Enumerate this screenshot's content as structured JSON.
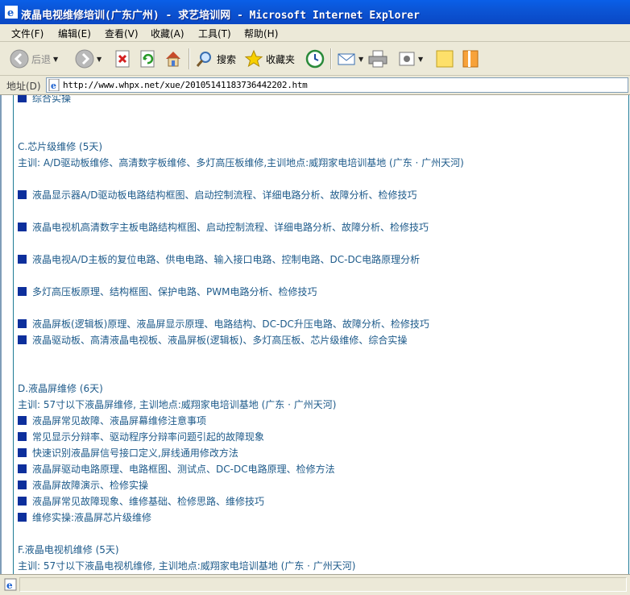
{
  "window": {
    "title": "液晶电视维修培训(广东广州) - 求艺培训网 - Microsoft Internet Explorer"
  },
  "menu": {
    "items": [
      {
        "label": "文件(F)"
      },
      {
        "label": "编辑(E)"
      },
      {
        "label": "查看(V)"
      },
      {
        "label": "收藏(A)"
      },
      {
        "label": "工具(T)"
      },
      {
        "label": "帮助(H)"
      }
    ]
  },
  "toolbar": {
    "back_label": "后退",
    "search_label": "搜索",
    "favorites_label": "收藏夹"
  },
  "address": {
    "label": "地址(D)",
    "url": "http://www.whpx.net/xue/20105141183736442202.htm"
  },
  "content": {
    "lines": [
      {
        "bullet": true,
        "text": "综合实操"
      },
      {
        "bullet": false,
        "text": "C.芯片级维修 (5天)"
      },
      {
        "bullet": false,
        "text": "主训: A/D驱动板维修、高清数字板维修、多灯高压板维修,主训地点:威翔家电培训基地 (广东 · 广州天河)"
      },
      {
        "bullet": true,
        "text": "液晶显示器A/D驱动板电路结构框图、启动控制流程、详细电路分析、故障分析、检修技巧"
      },
      {
        "bullet": true,
        "text": "液晶电视机高清数字主板电路结构框图、启动控制流程、详细电路分析、故障分析、检修技巧"
      },
      {
        "bullet": true,
        "text": "液晶电视A/D主板的复位电路、供电电路、输入接口电路、控制电路、DC-DC电路原理分析"
      },
      {
        "bullet": true,
        "text": "多灯高压板原理、结构框图、保护电路、PWM电路分析、检修技巧"
      },
      {
        "bullet": true,
        "text": "液晶屏板(逻辑板)原理、液晶屏显示原理、电路结构、DC-DC升压电路、故障分析、检修技巧"
      },
      {
        "bullet": true,
        "text": "液晶驱动板、高清液晶电视板、液晶屏板(逻辑板)、多灯高压板、芯片级维修、综合实操"
      },
      {
        "bullet": false,
        "text": "D.液晶屏维修 (6天)"
      },
      {
        "bullet": false,
        "text": "主训: 57寸以下液晶屏维修, 主训地点:威翔家电培训基地 (广东 · 广州天河)"
      },
      {
        "bullet": true,
        "text": "液晶屏常见故障、液晶屏幕维修注意事项"
      },
      {
        "bullet": true,
        "text": "常见显示分辩率、驱动程序分辩率问题引起的故障现象"
      },
      {
        "bullet": true,
        "text": "快速识别液晶屏信号接口定义,屏线通用修改方法"
      },
      {
        "bullet": true,
        "text": "液晶屏驱动电路原理、电路框图、测试点、DC-DC电路原理、检修方法"
      },
      {
        "bullet": true,
        "text": "液晶屏故障演示、检修实操"
      },
      {
        "bullet": true,
        "text": "液晶屏常见故障现象、维修基础、检修思路、维修技巧"
      },
      {
        "bullet": true,
        "text": "维修实操:液晶屏芯片级维修"
      },
      {
        "bullet": false,
        "text": "F.液晶电视机维修 (5天)"
      },
      {
        "bullet": false,
        "text": "主训: 57寸以下液晶电视机维修, 主训地点:威翔家电培训基地 (广东 · 广州天河)"
      }
    ]
  },
  "colors": {
    "text": "#1d5a8a",
    "bullet": "#0d2f9c",
    "titlebar": "#0a55d6"
  }
}
